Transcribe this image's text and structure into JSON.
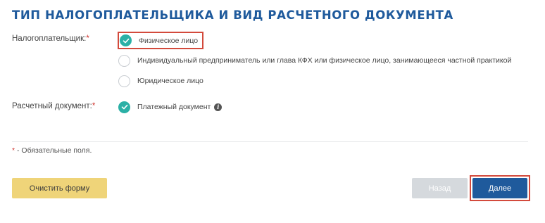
{
  "title": "ТИП НАЛОГОПЛАТЕЛЬЩИКА И ВИД РАСЧЕТНОГО ДОКУМЕНТА",
  "taxpayer": {
    "label": "Налогоплательщик:",
    "required_mark": "*",
    "options": [
      {
        "label": "Физическое лицо",
        "checked": true
      },
      {
        "label": "Индивидуальный предприниматель или глава КФХ или физическое лицо, занимающееся частной практикой",
        "checked": false
      },
      {
        "label": "Юридическое лицо",
        "checked": false
      }
    ]
  },
  "document": {
    "label": "Расчетный документ:",
    "required_mark": "*",
    "options": [
      {
        "label": "Платежный документ",
        "checked": true,
        "info_icon": "info-icon"
      }
    ]
  },
  "required_note": {
    "mark": "*",
    "text": " - Обязательные поля."
  },
  "buttons": {
    "clear": "Очистить форму",
    "back": "Назад",
    "next": "Далее"
  },
  "colors": {
    "accent_blue": "#1f5a9c",
    "check_teal": "#2bb0a6",
    "clear_button": "#efd479",
    "disabled_button": "#d5d9dd",
    "highlight_red": "#d34a3c",
    "required_red": "#d0352f"
  }
}
